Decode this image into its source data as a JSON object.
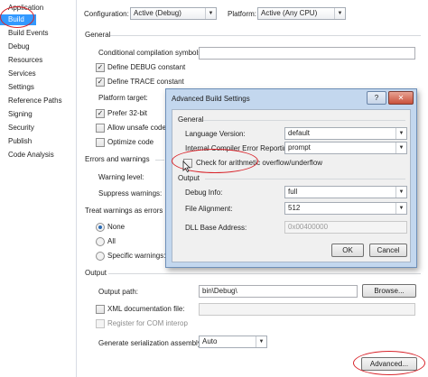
{
  "sidebar": {
    "items": [
      {
        "label": "Application"
      },
      {
        "label": "Build"
      },
      {
        "label": "Build Events"
      },
      {
        "label": "Debug"
      },
      {
        "label": "Resources"
      },
      {
        "label": "Services"
      },
      {
        "label": "Settings"
      },
      {
        "label": "Reference Paths"
      },
      {
        "label": "Signing"
      },
      {
        "label": "Security"
      },
      {
        "label": "Publish"
      },
      {
        "label": "Code Analysis"
      }
    ],
    "active_index": 1
  },
  "toolbar": {
    "configuration_label": "Configuration:",
    "configuration_value": "Active (Debug)",
    "platform_label": "Platform:",
    "platform_value": "Active (Any CPU)"
  },
  "general": {
    "header": "General",
    "conditional_symbols_label": "Conditional compilation symbols:",
    "conditional_symbols_value": "",
    "define_debug_label": "Define DEBUG constant",
    "define_debug_checked": true,
    "define_trace_label": "Define TRACE constant",
    "define_trace_checked": true,
    "platform_target_label": "Platform target:",
    "prefer32_label": "Prefer 32-bit",
    "prefer32_checked": true,
    "allow_unsafe_label": "Allow unsafe code",
    "allow_unsafe_checked": false,
    "optimize_label": "Optimize code",
    "optimize_checked": false
  },
  "errors": {
    "header": "Errors and warnings",
    "warning_level_label": "Warning level:",
    "suppress_label": "Suppress warnings:"
  },
  "treat_warnings": {
    "header": "Treat warnings as errors",
    "none_label": "None",
    "all_label": "All",
    "specific_label": "Specific warnings:",
    "selected": "None"
  },
  "output": {
    "header": "Output",
    "path_label": "Output path:",
    "path_value": "bin\\Debug\\",
    "browse_label": "Browse...",
    "xml_doc_label": "XML documentation file:",
    "xml_doc_checked": false,
    "register_com_label": "Register for COM interop",
    "register_com_checked": false,
    "serialization_label": "Generate serialization assembly:",
    "serialization_value": "Auto",
    "advanced_label": "Advanced..."
  },
  "dialog": {
    "title": "Advanced Build Settings",
    "help_label": "?",
    "close_label": "✕",
    "general_header": "General",
    "language_version_label": "Language Version:",
    "language_version_value": "default",
    "ice_reporting_label": "Internal Compiler Error Reporting:",
    "ice_reporting_value": "prompt",
    "overflow_label": "Check for arithmetic overflow/underflow",
    "overflow_checked": false,
    "output_header": "Output",
    "debug_info_label": "Debug Info:",
    "debug_info_value": "full",
    "file_alignment_label": "File Alignment:",
    "file_alignment_value": "512",
    "dll_base_label": "DLL Base Address:",
    "dll_base_value": "0x00400000",
    "ok_label": "OK",
    "cancel_label": "Cancel"
  },
  "icons": [
    "dropdown-arrow-icon",
    "help-icon",
    "close-icon",
    "mouse-cursor-icon",
    "checkmark-icon"
  ],
  "colors": {
    "selection": "#3399ff",
    "annotation": "#d8232a",
    "dialog_frame": "#c3d7ee"
  }
}
